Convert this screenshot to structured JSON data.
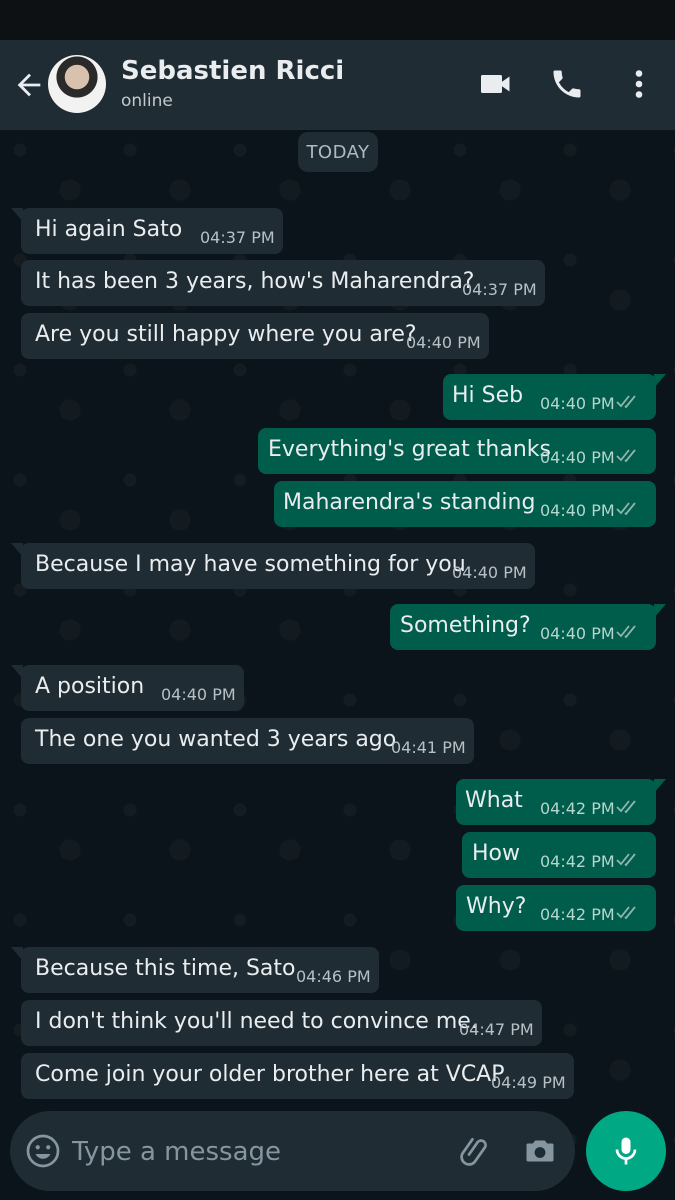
{
  "header": {
    "contact_name": "Sebastien Ricci",
    "contact_status": "online",
    "icons": [
      "back-arrow-icon",
      "video-call-icon",
      "phone-icon",
      "more-options-icon"
    ]
  },
  "date_separator": "TODAY",
  "messages": [
    {
      "direction": "in",
      "text": "Hi again Sato",
      "time": "04:37 PM",
      "tail": true
    },
    {
      "direction": "in",
      "text": "It has been 3 years, how's Maharendra?",
      "time": "04:37 PM",
      "tail": false
    },
    {
      "direction": "in",
      "text": "Are you still happy where you are?",
      "time": "04:40 PM",
      "tail": false
    },
    {
      "direction": "out",
      "text": "Hi Seb",
      "time": "04:40 PM",
      "tail": true,
      "status": "read"
    },
    {
      "direction": "out",
      "text": "Everything's great thanks",
      "time": "04:40 PM",
      "tail": false,
      "status": "read"
    },
    {
      "direction": "out",
      "text": "Maharendra's standing",
      "time": "04:40 PM",
      "tail": false,
      "status": "read"
    },
    {
      "direction": "in",
      "text": "Because I may have something for you",
      "time": "04:40 PM",
      "tail": true
    },
    {
      "direction": "out",
      "text": "Something?",
      "time": "04:40 PM",
      "tail": true,
      "status": "read"
    },
    {
      "direction": "in",
      "text": "A position",
      "time": "04:40 PM",
      "tail": true
    },
    {
      "direction": "in",
      "text": "The one you wanted 3 years ago",
      "time": "04:41 PM",
      "tail": false
    },
    {
      "direction": "out",
      "text": "What",
      "time": "04:42 PM",
      "tail": true,
      "status": "read"
    },
    {
      "direction": "out",
      "text": "How",
      "time": "04:42 PM",
      "tail": false,
      "status": "read"
    },
    {
      "direction": "out",
      "text": "Why?",
      "time": "04:42 PM",
      "tail": false,
      "status": "read"
    },
    {
      "direction": "in",
      "text": "Because this time, Sato",
      "time": "04:46 PM",
      "tail": true
    },
    {
      "direction": "in",
      "text": "I don't think you'll need to convince me.",
      "time": "04:47 PM",
      "tail": false
    },
    {
      "direction": "in",
      "text": "Come join your older brother here at VCAP",
      "time": "04:49 PM",
      "tail": false
    }
  ],
  "composer": {
    "placeholder": "Type a message",
    "icons": [
      "emoji-icon",
      "attach-icon",
      "camera-icon",
      "microphone-icon"
    ]
  },
  "colors": {
    "header_bg": "#1f2c33",
    "incoming_bubble": "#202c33",
    "outgoing_bubble": "#005c4b",
    "accent": "#00a884"
  }
}
